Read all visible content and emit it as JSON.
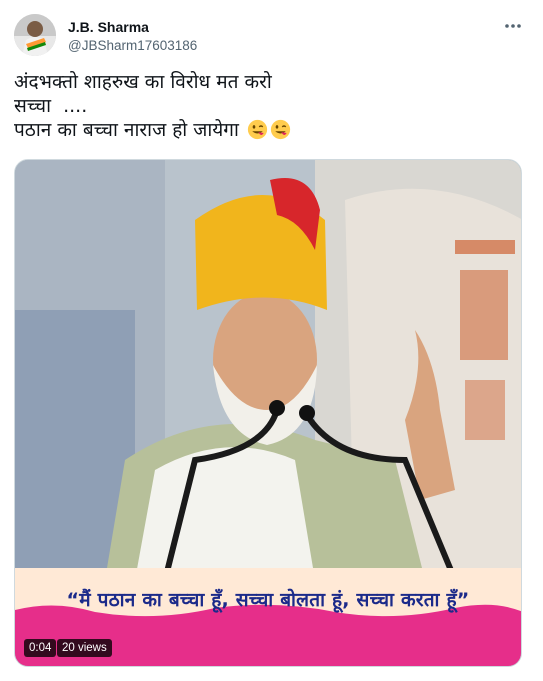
{
  "author": {
    "name": "J.B. Sharma",
    "handle": "@JBSharm17603186"
  },
  "tweet": {
    "lines": [
      "अंदभक्तो शाहरुख का विरोध मत करो",
      "सच्चा  ....",
      "पठान का बच्चा नाराज हो जायेगा"
    ],
    "emojis": [
      "winking-face-with-tongue",
      "winking-face-with-tongue"
    ]
  },
  "media": {
    "caption": "“मैं पठान का बच्चा हूँ, सच्चा बोलता हूं, सच्चा करता हूँ”",
    "duration": "0:04",
    "views": "20 views",
    "caption_bar_color": "#e62e8a"
  },
  "icons": {
    "more": "more-options-icon"
  }
}
